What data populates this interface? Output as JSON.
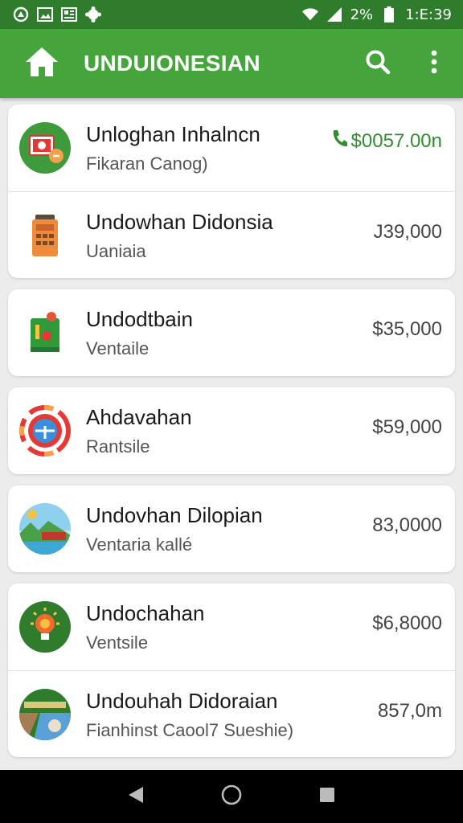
{
  "status_bar": {
    "battery_text": "2%",
    "time": "1:E:39",
    "icons": [
      "app-notification-icon",
      "image-icon",
      "news-icon",
      "settings-icon",
      "wifi-icon",
      "signal-icon",
      "battery-icon"
    ]
  },
  "app_bar": {
    "title": "UNDUIONESIAN",
    "background": "#45a43b",
    "icons": [
      "home-icon",
      "search-icon",
      "more-vert-icon"
    ]
  },
  "items": [
    {
      "title": "Unloghan Inhalncn",
      "subtitle": "Fikaran Canog)",
      "price": "$0057.00n",
      "price_icon": "phone-icon",
      "icon": "gallery-icon",
      "highlight": true
    },
    {
      "title": "Undowhan Didonsia",
      "subtitle": "Uaniaia",
      "price": "J39,000",
      "icon": "calculator-icon"
    },
    {
      "title": "Undodtbain",
      "subtitle": "Ventaile",
      "price": "$35,000",
      "icon": "green-book-icon"
    },
    {
      "title": "Ahdavahan",
      "subtitle": "Rantsile",
      "price": "$59,000",
      "icon": "color-wheel-icon"
    },
    {
      "title": "Undovhan Dilopian",
      "subtitle": "Ventaria kallé",
      "price": "83,0000",
      "icon": "landscape-icon"
    },
    {
      "title": "Undochahan",
      "subtitle": "Ventsile",
      "price": "$6,8000",
      "icon": "lightbulb-icon"
    },
    {
      "title": "Undouhah Didoraian",
      "subtitle": "Fianhinst Caool7 Sueshie)",
      "price": "857,0m",
      "icon": "map-icon"
    }
  ],
  "nav_bar": {
    "icons": [
      "back-icon",
      "home-circle-icon",
      "recents-icon"
    ]
  }
}
